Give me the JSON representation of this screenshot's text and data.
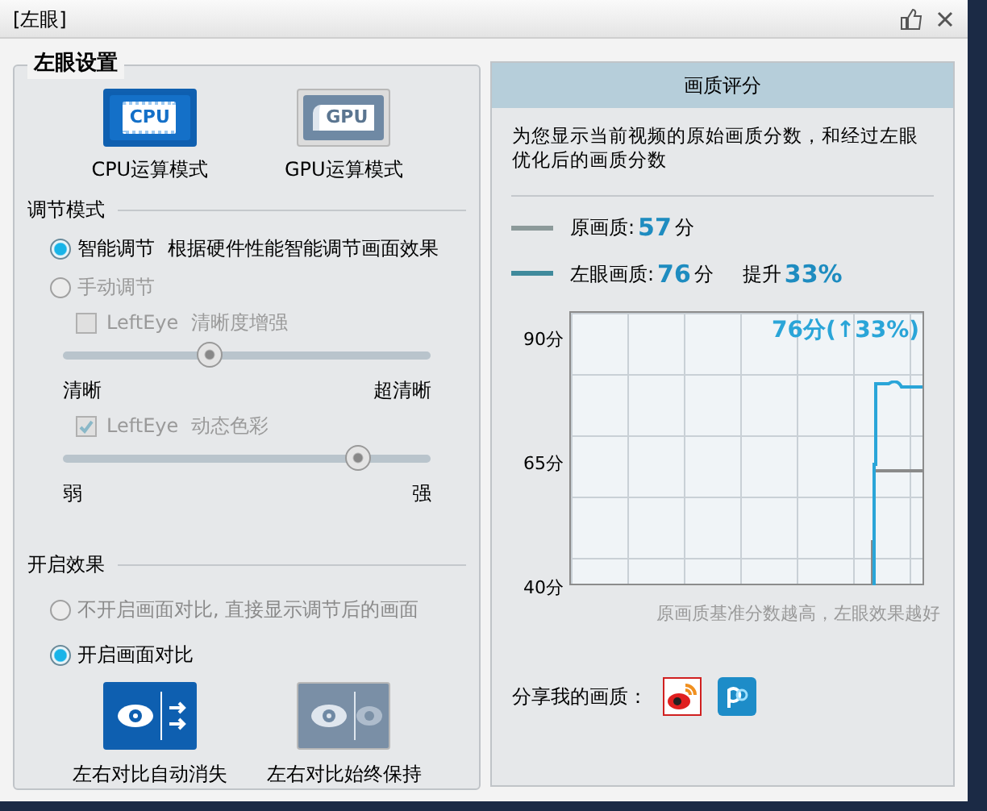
{
  "window": {
    "title": "[左眼]"
  },
  "settings": {
    "title": "左眼设置",
    "modes": [
      {
        "kind": "cpu",
        "chip": "CPU",
        "label": "CPU运算模式",
        "selected": true
      },
      {
        "kind": "gpu",
        "chip": "GPU",
        "label": "GPU运算模式",
        "selected": false
      }
    ],
    "adjust": {
      "title": "调节模式",
      "options": [
        {
          "label": "智能调节",
          "note": "根据硬件性能智能调节画面效果",
          "selected": true,
          "disabled": false
        },
        {
          "label": "手动调节",
          "selected": false,
          "disabled": true
        }
      ],
      "controls": [
        {
          "label": "LeftEye  清晰度增强",
          "checked": false,
          "disabled": true,
          "level": 0.4,
          "min_label": "清晰",
          "max_label": "超清晰"
        },
        {
          "label": "LeftEye  动态色彩",
          "checked": true,
          "disabled": true,
          "level": 0.8,
          "min_label": "弱",
          "max_label": "强"
        }
      ]
    },
    "effect": {
      "title": "开启效果",
      "options": [
        {
          "label": "不开启画面对比, 直接显示调节后的画面",
          "selected": false
        },
        {
          "label": "开启画面对比",
          "selected": true
        }
      ],
      "compare_modes": [
        {
          "kind": "auto",
          "label": "左右对比自动消失",
          "selected": true
        },
        {
          "kind": "keep",
          "label": "左右对比始终保持",
          "selected": false
        }
      ]
    }
  },
  "quality": {
    "title": "画质评分",
    "description": "为您显示当前视频的原始画质分数，和经过左眼优化后的画质分数",
    "legend": [
      {
        "label": "原画质:",
        "score": "57",
        "unit": "分",
        "color": "#8c9a9a"
      },
      {
        "label": "左眼画质:",
        "score": "76",
        "unit": "分",
        "color": "#3f8a9c",
        "boost_label": "提升",
        "boost": "33%"
      }
    ],
    "graph": {
      "overlay": "76分(↑33%)",
      "y_labels": [
        "90分",
        "65分",
        "40分"
      ],
      "caption": "原画质基准分数越高，左眼效果越好"
    },
    "share_label": "分享我的画质："
  }
}
